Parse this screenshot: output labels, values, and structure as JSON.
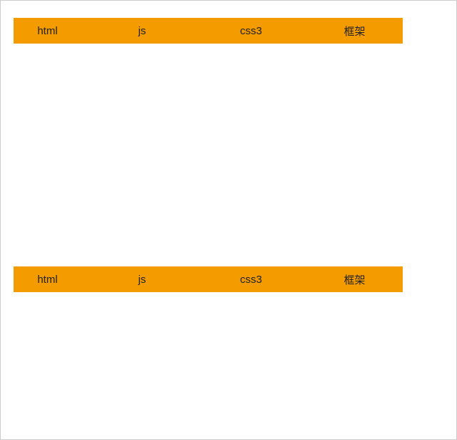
{
  "navbars": [
    {
      "items": [
        {
          "label": "html"
        },
        {
          "label": "js"
        },
        {
          "label": "css3"
        },
        {
          "label": "框架"
        }
      ]
    },
    {
      "items": [
        {
          "label": "html"
        },
        {
          "label": "js"
        },
        {
          "label": "css3"
        },
        {
          "label": "框架"
        }
      ]
    }
  ],
  "colors": {
    "navBackground": "#f49b00"
  }
}
